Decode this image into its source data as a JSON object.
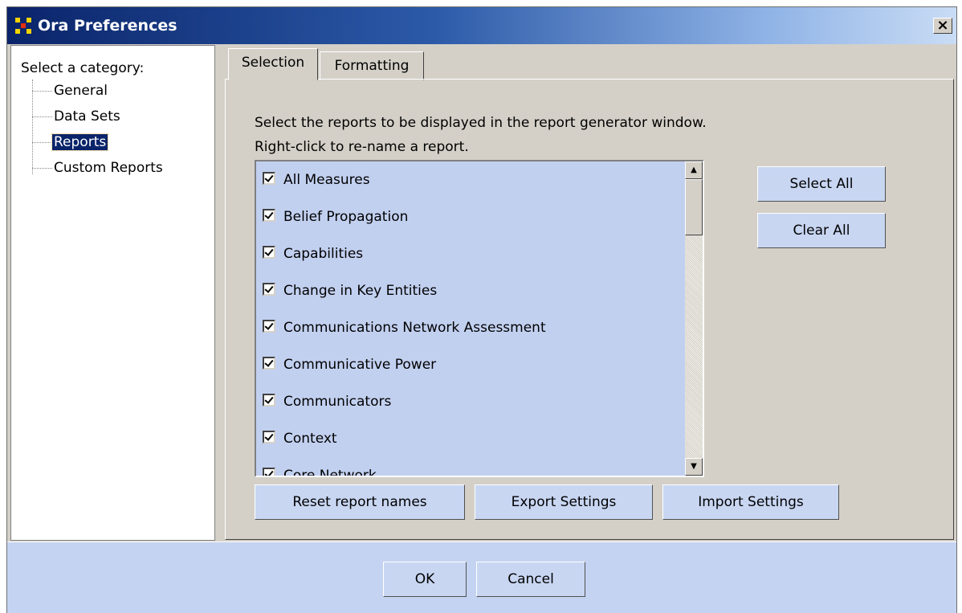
{
  "window": {
    "title": "Ora Preferences",
    "close_glyph": "×"
  },
  "sidebar": {
    "heading": "Select a category:",
    "items": [
      {
        "label": "General",
        "selected": false
      },
      {
        "label": "Data Sets",
        "selected": false
      },
      {
        "label": "Reports",
        "selected": true
      },
      {
        "label": "Custom Reports",
        "selected": false
      }
    ]
  },
  "tabs": [
    {
      "label": "Selection",
      "active": true
    },
    {
      "label": "Formatting",
      "active": false
    }
  ],
  "selection": {
    "instruction_line1": "Select the reports to be displayed in the report generator window.",
    "instruction_line2": "Right-click to re-name a report.",
    "reports": [
      {
        "label": "All Measures",
        "checked": true
      },
      {
        "label": "Belief Propagation",
        "checked": true
      },
      {
        "label": "Capabilities",
        "checked": true
      },
      {
        "label": "Change in Key Entities",
        "checked": true
      },
      {
        "label": "Communications Network Assessment",
        "checked": true
      },
      {
        "label": "Communicative Power",
        "checked": true
      },
      {
        "label": "Communicators",
        "checked": true
      },
      {
        "label": "Context",
        "checked": true
      },
      {
        "label": "Core Network",
        "checked": true
      }
    ],
    "select_all_label": "Select All",
    "clear_all_label": "Clear All",
    "reset_names_label": "Reset report names",
    "export_label": "Export Settings",
    "import_label": "Import Settings"
  },
  "footer": {
    "ok_label": "OK",
    "cancel_label": "Cancel"
  },
  "colors": {
    "title_gradient_start": "#0a246a",
    "panel_bg": "#d4d0c8",
    "list_bg": "#c2d0f0",
    "button_bg": "#c8d6f2",
    "footer_bg": "#c4d3f1",
    "selected_item_bg": "#0a246a"
  },
  "icons": {
    "app": "ora-grid-icon",
    "close": "close-icon",
    "scroll_up": "scroll-up-arrow-icon",
    "scroll_down": "scroll-down-arrow-icon",
    "checkbox": "checkbox-checked-icon"
  }
}
